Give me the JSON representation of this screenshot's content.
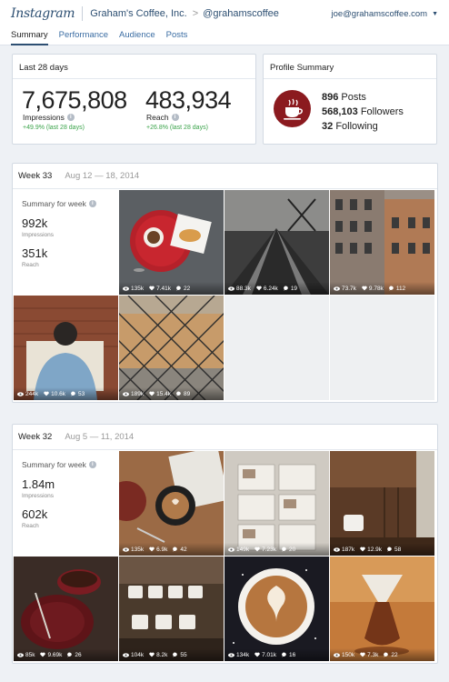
{
  "header": {
    "logo": "Instagram",
    "account_name": "Graham's Coffee, Inc.",
    "separator": ">",
    "handle": "@grahamscoffee",
    "user_email": "joe@grahamscoffee.com",
    "menu_caret": "▼"
  },
  "tabs": [
    {
      "label": "Summary",
      "active": true
    },
    {
      "label": "Performance",
      "active": false
    },
    {
      "label": "Audience",
      "active": false
    },
    {
      "label": "Posts",
      "active": false
    }
  ],
  "overview": {
    "title": "Last 28 days",
    "impressions": {
      "value": "7,675,808",
      "label": "Impressions",
      "change": "+49.9% (last 28 days)"
    },
    "reach": {
      "value": "483,934",
      "label": "Reach",
      "change": "+26.8% (last 28 days)"
    }
  },
  "profile": {
    "title": "Profile Summary",
    "posts": {
      "value": "896",
      "label": "Posts"
    },
    "followers": {
      "value": "568,103",
      "label": "Followers"
    },
    "following": {
      "value": "32",
      "label": "Following"
    }
  },
  "weeks": [
    {
      "label": "Week 33",
      "dates": "Aug 12 — 18, 2014",
      "summary_title": "Summary for week",
      "impressions": "992k",
      "impressions_label": "Impressions",
      "reach": "351k",
      "reach_label": "Reach",
      "posts": [
        {
          "views": "135k",
          "likes": "7.41k",
          "comments": "22"
        },
        {
          "views": "88.3k",
          "likes": "6.24k",
          "comments": "19"
        },
        {
          "views": "73.7k",
          "likes": "9.78k",
          "comments": "112"
        },
        {
          "views": "244k",
          "likes": "10.6k",
          "comments": "53"
        },
        {
          "views": "189k",
          "likes": "15.4k",
          "comments": "89"
        }
      ]
    },
    {
      "label": "Week 32",
      "dates": "Aug 5 — 11, 2014",
      "summary_title": "Summary for week",
      "impressions": "1.84m",
      "impressions_label": "Impressions",
      "reach": "602k",
      "reach_label": "Reach",
      "posts": [
        {
          "views": "135k",
          "likes": "6.9k",
          "comments": "42"
        },
        {
          "views": "149k",
          "likes": "7.23k",
          "comments": "20"
        },
        {
          "views": "187k",
          "likes": "12.9k",
          "comments": "58"
        },
        {
          "views": "85k",
          "likes": "9.69k",
          "comments": "26"
        },
        {
          "views": "104k",
          "likes": "8.2k",
          "comments": "55"
        },
        {
          "views": "134k",
          "likes": "7.01k",
          "comments": "16"
        },
        {
          "views": "150k",
          "likes": "7.3k",
          "comments": "22"
        }
      ]
    }
  ]
}
